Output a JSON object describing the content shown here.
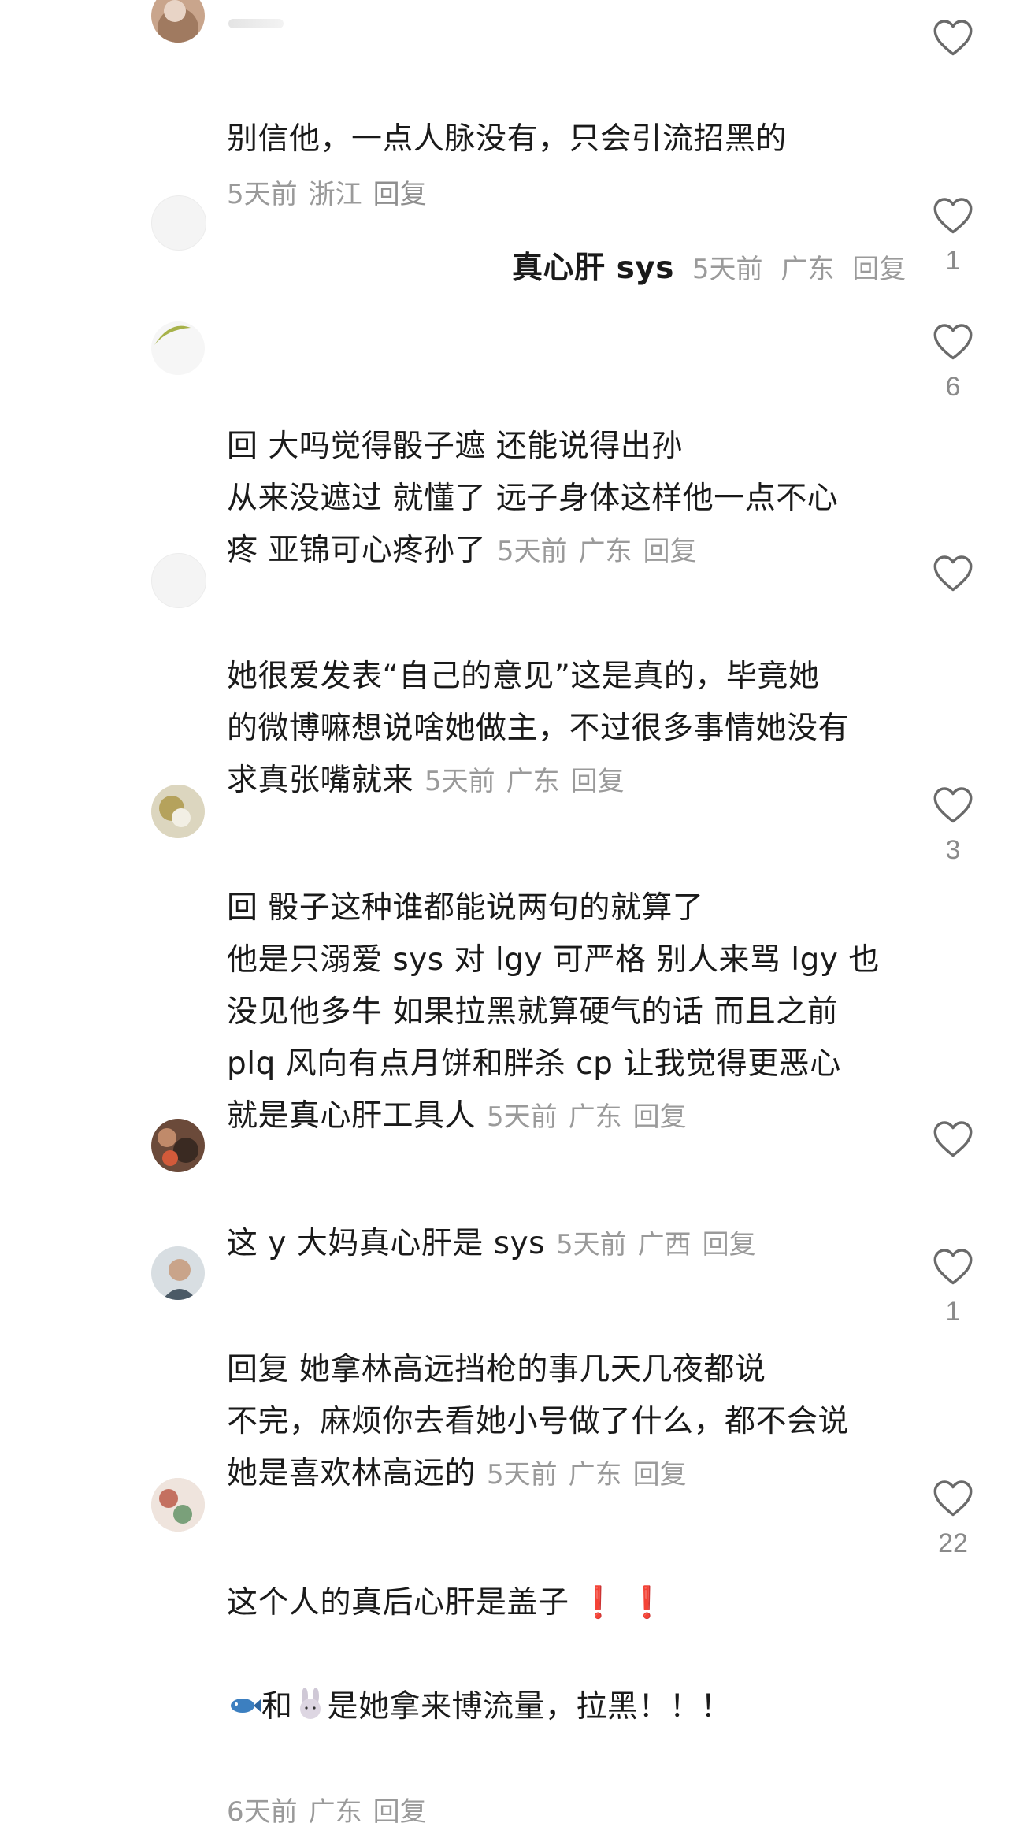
{
  "comments": [
    {
      "text": "别信他，一点人脉没有，只会引流招黑的",
      "time": "5天前",
      "location": "浙江",
      "reply": "回复",
      "likes": ""
    },
    {
      "text": "真心肝 sys",
      "time": "5天前",
      "location": "广东",
      "reply": "回复",
      "likes": "1"
    },
    {
      "text": "回                  大吗觉得骰子遮 还能说得出孙\n从来没遮过 就懂了 远子身体这样他一点不心\n疼 亚锦可心疼孙了",
      "time": "5天前",
      "location": "广东",
      "reply": "回复",
      "likes": "6"
    },
    {
      "text": "她很爱发表“自己的意见”这是真的，毕竟她\n的微博嘛想说啥她做主，不过很多事情她没有\n求真张嘴就来",
      "time": "5天前",
      "location": "广东",
      "reply": "回复",
      "likes": ""
    },
    {
      "text": "回                骰子这种谁都能说两句的就算了\n他是只溺爱 sys 对 lgy 可严格 别人来骂 lgy 也\n没见他多牛 如果拉黑就算硬气的话 而且之前\nplq 风向有点月饼和胖杀 cp 让我觉得更恶心\n就是真心肝工具人",
      "time": "5天前",
      "location": "广东",
      "reply": "回复",
      "likes": "3"
    },
    {
      "text": "这 y 大妈真心肝是 sys",
      "time": "5天前",
      "location": "广西",
      "reply": "回复",
      "likes": ""
    },
    {
      "text": "回复              她拿林高远挡枪的事几天几夜都说\n不完，麻烦你去看她小号做了什么，都不会说\n她是喜欢林高远的",
      "time": "5天前",
      "location": "广东",
      "reply": "回复",
      "likes": "1"
    },
    {
      "text": "这个人的真后心肝是盖子 ❗ ❗",
      "text2_mid": "和",
      "text2_end": "是她拿来博流量，拉黑！！！",
      "emoji1": "fish-emoji",
      "emoji2": "rabbit-emoji",
      "time": "6天前",
      "location": "广东",
      "reply": "回复",
      "likes": "22"
    }
  ],
  "icons": {
    "like": "heart-outline-icon"
  },
  "colors": {
    "meta": "#9a9a9a",
    "exclaim": "#e02020"
  }
}
